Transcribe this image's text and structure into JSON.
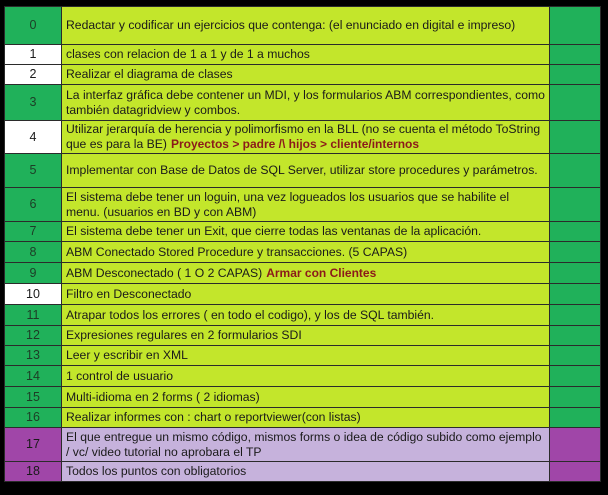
{
  "colors": {
    "green": "#20b15a",
    "lime": "#c3e62b",
    "white": "#ffffff",
    "purple": "#a046a8",
    "lavender": "#c6b2dc",
    "note_red": "#8b1a1a"
  },
  "rows": [
    {
      "num": "0",
      "text": "Redactar y codificar un ejercicios que contenga: (el enunciado en digital e impreso)",
      "note": "",
      "style": "green",
      "height": 38
    },
    {
      "num": "1",
      "text": "clases con relacion de 1 a 1 y de 1 a muchos",
      "note": "",
      "style": "white",
      "height": 20
    },
    {
      "num": "2",
      "text": "Realizar el diagrama de clases",
      "note": "",
      "style": "white",
      "height": 20
    },
    {
      "num": "3",
      "text": "La interfaz gráfica debe contener un MDI,  y los formularios ABM correspondientes, como también  datagridview  y combos.",
      "note": "",
      "style": "green",
      "height": 36
    },
    {
      "num": "4",
      "text": "Utilizar jerarquía de herencia y polimorfismo en la BLL (no se cuenta el método ToString que es para la BE)",
      "note": "Proyectos > padre /\\ hijos >  cliente/internos",
      "style": "white",
      "height": 33
    },
    {
      "num": "5",
      "text": "Implementar con Base de Datos de SQL Server, utilizar store procedures y parámetros.",
      "note": "",
      "style": "green",
      "height": 34
    },
    {
      "num": "6",
      "text": "El sistema debe tener un loguin, una vez logueados los usuarios que se habilite el menu. (usuarios en BD y con ABM)",
      "note": "",
      "style": "green",
      "height": 34
    },
    {
      "num": "7",
      "text": "El sistema debe tener un Exit, que cierre todas las ventanas de la aplicación.",
      "note": "",
      "style": "green",
      "height": 20
    },
    {
      "num": "8",
      "text": "ABM Conectado Stored Procedure y transacciones. (5 CAPAS)",
      "note": "",
      "style": "green",
      "height": 21
    },
    {
      "num": "9",
      "text": "ABM Desconectado ( 1 O 2 CAPAS)",
      "note": "Armar con Clientes",
      "style": "green",
      "height": 21
    },
    {
      "num": "10",
      "text": "Filtro en Desconectado",
      "note": "",
      "style": "white",
      "height": 21
    },
    {
      "num": "11",
      "text": "Atrapar todos los errores ( en todo el codigo), y los de SQL también.",
      "note": "",
      "style": "green",
      "height": 21
    },
    {
      "num": "12",
      "text": "Expresiones regulares en 2 formularios SDI",
      "note": "",
      "style": "green",
      "height": 20
    },
    {
      "num": "13",
      "text": "Leer y escribir en XML",
      "note": "",
      "style": "green",
      "height": 20
    },
    {
      "num": "14",
      "text": "1 control de usuario",
      "note": "",
      "style": "green",
      "height": 21
    },
    {
      "num": "15",
      "text": "Multi-idioma en 2 forms ( 2 idiomas)",
      "note": "",
      "style": "green",
      "height": 21
    },
    {
      "num": "16",
      "text": "Realizar informes con : chart o reportviewer(con listas)",
      "note": "",
      "style": "green",
      "height": 20
    },
    {
      "num": "17",
      "text": "El que entregue un mismo código, mismos forms o idea de código subido como ejemplo / vc/ video tutorial no aprobara el TP",
      "note": "",
      "style": "purple",
      "height": 34
    },
    {
      "num": "18",
      "text": "Todos los puntos con obligatorios",
      "note": "",
      "style": "purple",
      "height": 20
    }
  ]
}
